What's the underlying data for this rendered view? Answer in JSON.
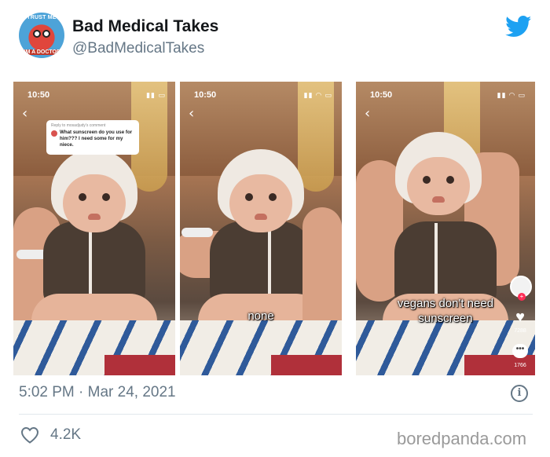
{
  "tweet": {
    "display_name": "Bad Medical Takes",
    "handle": "@BadMedicalTakes",
    "avatar_text_top": "TRUST ME",
    "avatar_text_bottom": "I'M A DOCTOR",
    "timestamp": "5:02 PM · Mar 24, 2021",
    "likes": "4.2K",
    "brand_color": "#1da1f2",
    "icons": [
      "twitter-bird-icon",
      "info-icon",
      "heart-outline-icon"
    ]
  },
  "media": {
    "panels": [
      {
        "clock": "10:50",
        "comment": {
          "reply_to": "Reply to mosadjudy's comment",
          "text": "What sunscreen do you use for him??? I need some for my niece."
        }
      },
      {
        "clock": "10:50",
        "caption": "none"
      },
      {
        "clock": "10:50",
        "caption_line1": "vegans don't need",
        "caption_line2": "sunscreen",
        "like_count": "7288",
        "comment_count": "1766"
      }
    ]
  },
  "watermark": "boredpanda.com"
}
